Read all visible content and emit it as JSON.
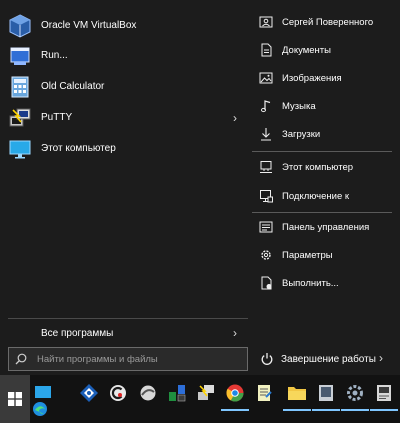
{
  "pinned_apps": [
    {
      "label": "Oracle VM VirtualBox",
      "icon": "virtualbox-icon"
    },
    {
      "label": "Run...",
      "icon": "run-icon"
    },
    {
      "label": "Old Calculator",
      "icon": "calculator-icon"
    },
    {
      "label": "PuTTY",
      "icon": "putty-icon",
      "arrow": "›"
    },
    {
      "label": "Этот компьютер",
      "icon": "monitor-icon"
    }
  ],
  "all_programs": {
    "label": "Все программы",
    "arrow": "›"
  },
  "search": {
    "placeholder": "Найти программы и файлы"
  },
  "places": [
    {
      "label": "Сергей Поверенного",
      "icon": "user-folder-icon"
    },
    {
      "label": "Документы",
      "icon": "document-icon"
    },
    {
      "label": "Изображения",
      "icon": "image-icon"
    },
    {
      "label": "Музыка",
      "icon": "music-note-icon"
    },
    {
      "label": "Загрузки",
      "icon": "download-arrow-icon"
    },
    {
      "label": "Этот компьютер",
      "icon": "computer-icon"
    },
    {
      "label": "Подключение к",
      "icon": "connect-icon"
    },
    {
      "label": "Панель управления",
      "icon": "control-panel-icon"
    },
    {
      "label": "Параметры",
      "icon": "gear-icon"
    },
    {
      "label": "Выполнить...",
      "icon": "run-dialog-icon"
    }
  ],
  "shutdown": {
    "label": "Завершение работы",
    "icon": "power-icon",
    "arrow": "›"
  },
  "taskbar": {
    "items": [
      {
        "name": "start",
        "icon": "windows-logo-icon"
      },
      {
        "name": "edge",
        "icon": "edge-icon"
      },
      {
        "name": "desktop",
        "icon": "desktop-icon"
      },
      {
        "name": "app-diamond",
        "icon": "diamond-app-icon"
      },
      {
        "name": "ccleaner",
        "icon": "ccleaner-icon"
      },
      {
        "name": "app-round",
        "icon": "round-app-icon"
      },
      {
        "name": "network-tool",
        "icon": "network-tool-icon"
      },
      {
        "name": "putty",
        "icon": "putty-icon"
      },
      {
        "name": "chrome",
        "icon": "chrome-icon"
      },
      {
        "name": "notepad",
        "icon": "notepad-icon"
      },
      {
        "name": "explorer",
        "icon": "folder-icon"
      },
      {
        "name": "virtualbox-window",
        "icon": "window-icon"
      },
      {
        "name": "remote",
        "icon": "remote-desktop-icon"
      },
      {
        "name": "settings",
        "icon": "settings-gear-icon"
      },
      {
        "name": "app-last",
        "icon": "last-app-icon"
      }
    ]
  },
  "colors": {
    "accent": "#7fc6ff",
    "menu_bg": "#1c1c1c",
    "taskbar_bg": "#121212"
  }
}
